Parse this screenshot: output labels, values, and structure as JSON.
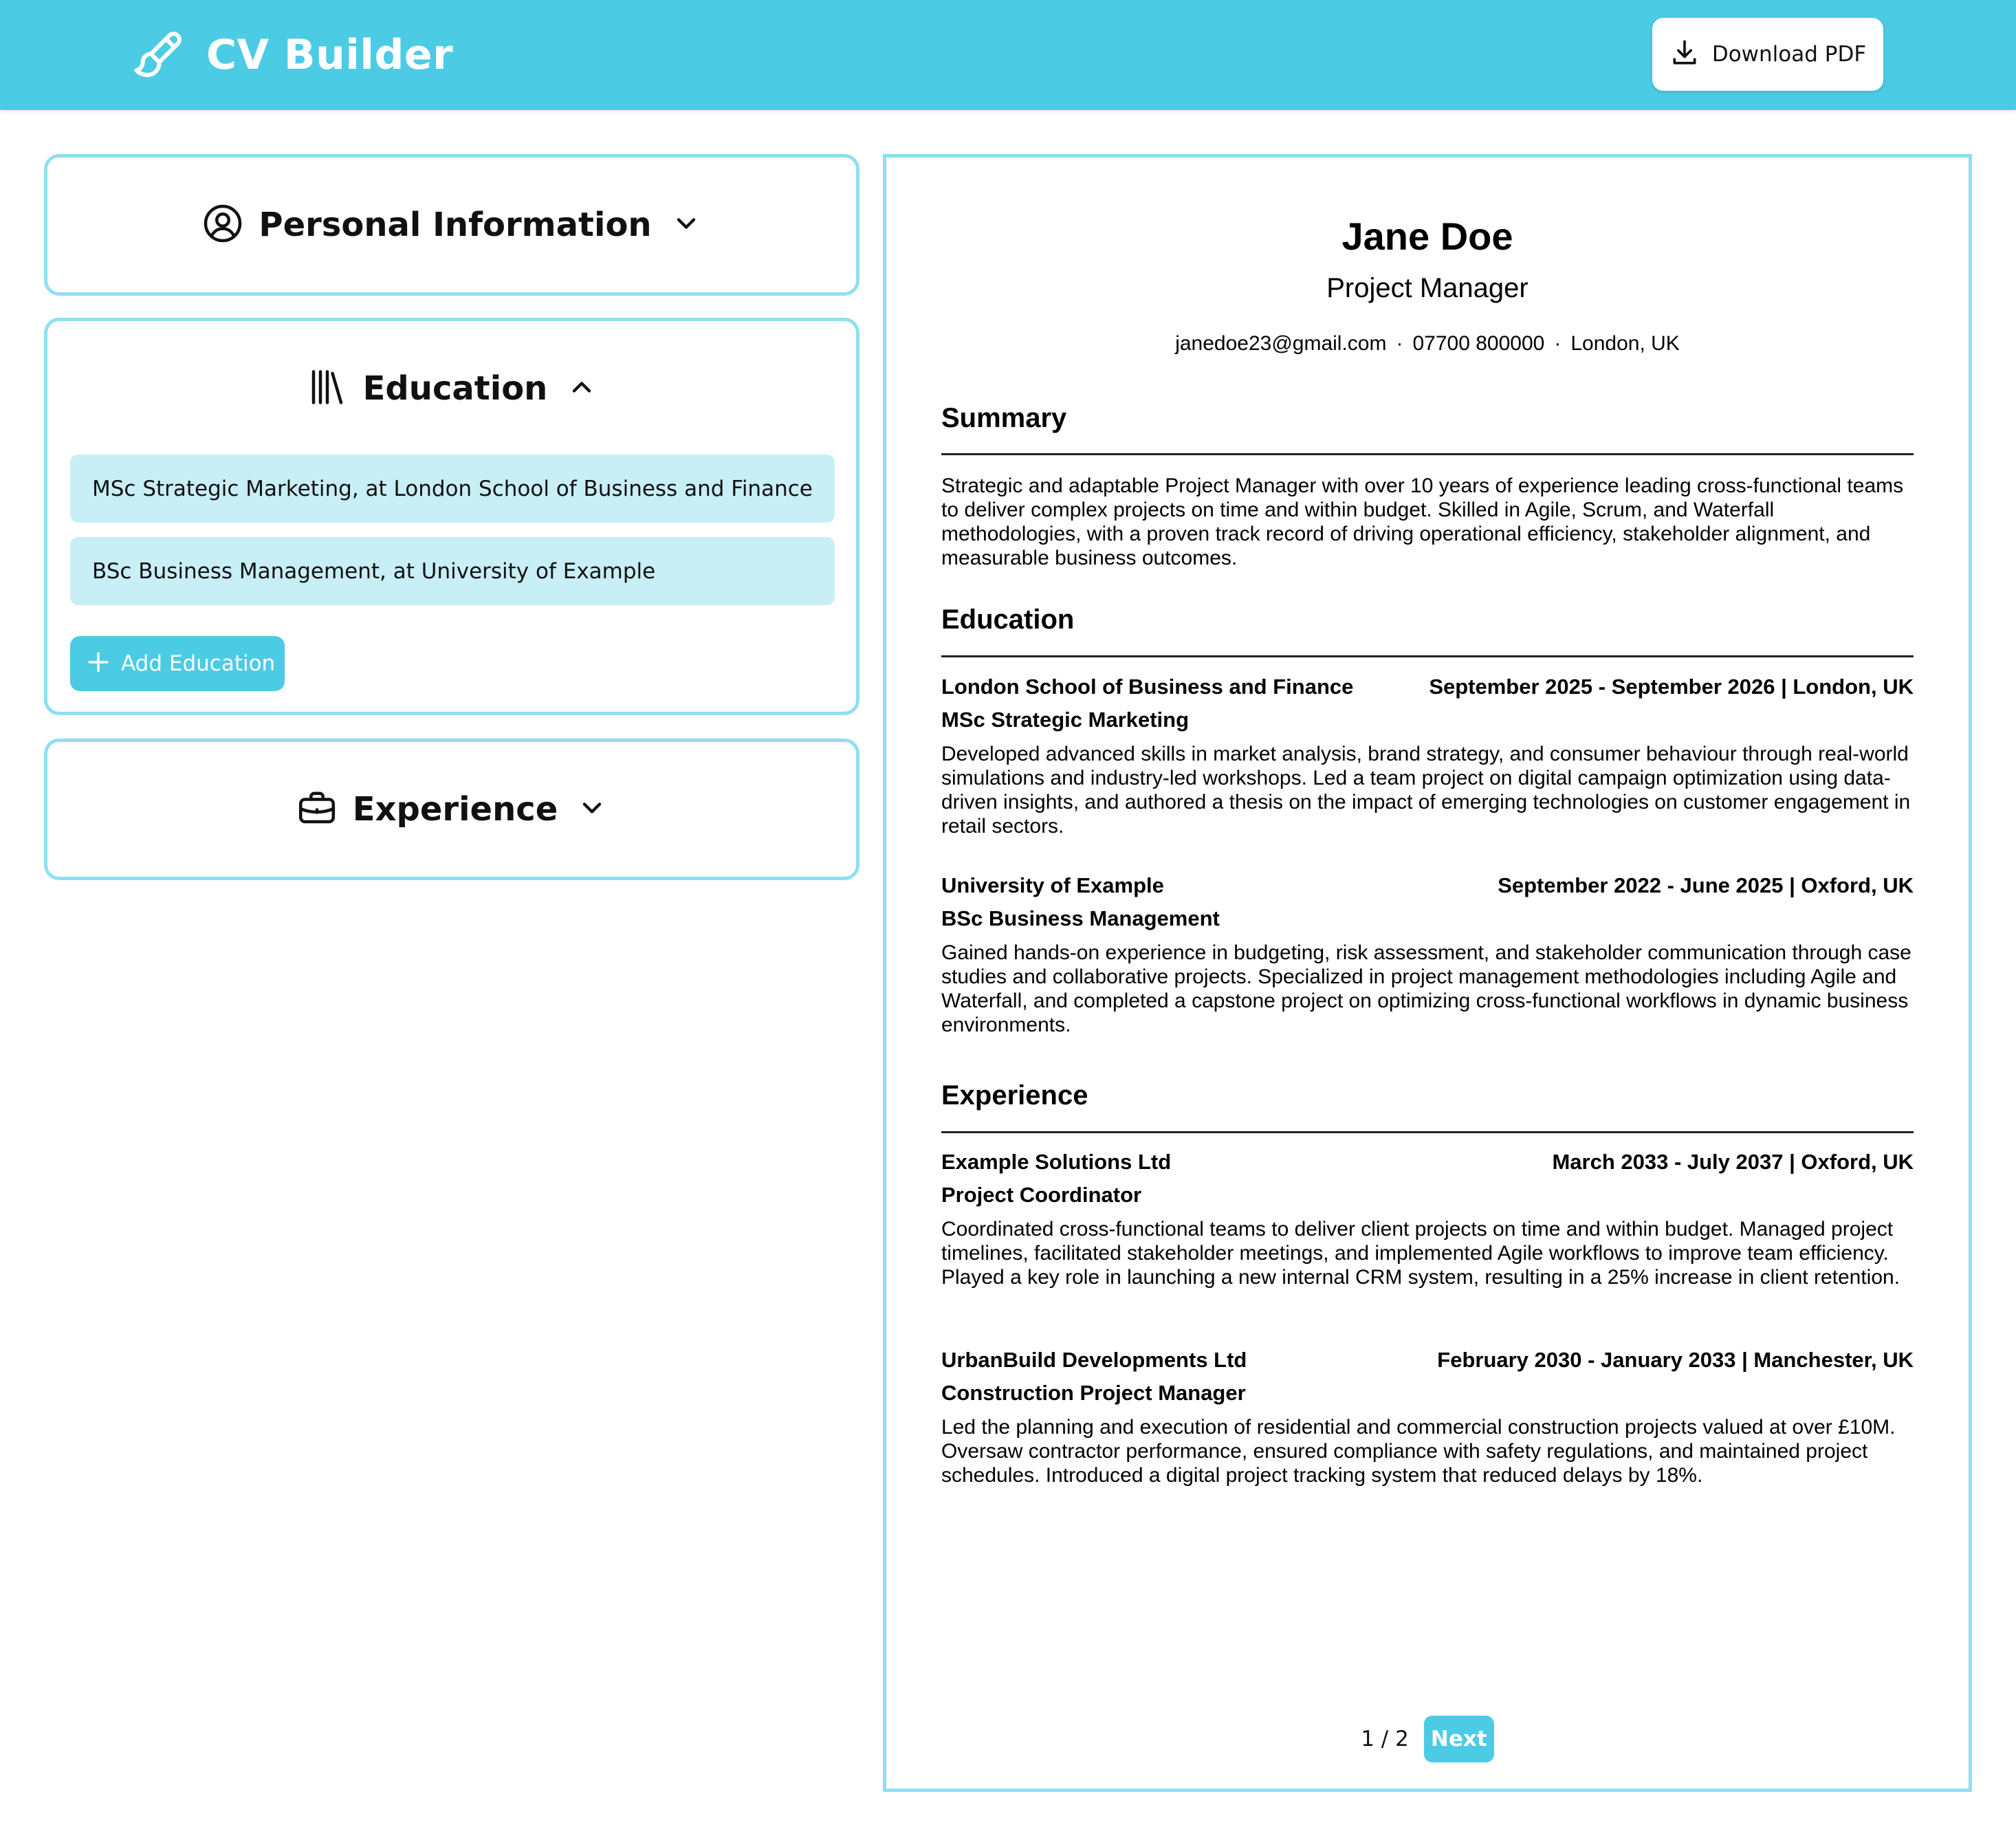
{
  "app": {
    "title": "CV Builder",
    "download_label": "Download PDF"
  },
  "panels": {
    "personal": {
      "title": "Personal Information"
    },
    "education": {
      "title": "Education",
      "items": [
        {
          "label": "MSc Strategic Marketing, at London School of Business and Finance"
        },
        {
          "label": "BSc Business Management, at University of Example"
        }
      ],
      "add_label": "Add Education"
    },
    "experience": {
      "title": "Experience"
    }
  },
  "cv": {
    "name": "Jane Doe",
    "role": "Project Manager",
    "email": "janedoe23@gmail.com",
    "phone": "07700 800000",
    "location": "London, UK",
    "separator": "·",
    "summary_title": "Summary",
    "summary": "Strategic and adaptable Project Manager with over 10 years of experience leading cross-functional teams to deliver complex projects on time and within budget. Skilled in Agile, Scrum, and Waterfall methodologies, with a proven track record of driving operational efficiency, stakeholder alignment, and measurable business outcomes.",
    "education_title": "Education",
    "education": [
      {
        "institution": "London School of Business and Finance",
        "dates_location": "September 2025 - September 2026 | London, UK",
        "degree": "MSc Strategic Marketing",
        "description": "Developed advanced skills in market analysis, brand strategy, and consumer behaviour through real-world simulations and industry-led workshops. Led a team project on digital campaign optimization using data-driven insights, and authored a thesis on the impact of emerging technologies on customer engagement in retail sectors."
      },
      {
        "institution": "University of Example",
        "dates_location": "September 2022 - June 2025 | Oxford, UK",
        "degree": "BSc Business Management",
        "description": "Gained hands-on experience in budgeting, risk assessment, and stakeholder communication through case studies and collaborative projects. Specialized in project management methodologies including Agile and Waterfall, and completed a capstone project on optimizing cross-functional workflows in dynamic business environments."
      }
    ],
    "experience_title": "Experience",
    "experience": [
      {
        "company": "Example Solutions Ltd",
        "dates_location": "March 2033 - July 2037 | Oxford, UK",
        "position": "Project Coordinator",
        "description": "Coordinated cross-functional teams to deliver client projects on time and within budget. Managed project timelines, facilitated stakeholder meetings, and implemented Agile workflows to improve team efficiency. Played a key role in launching a new internal CRM system, resulting in a 25% increase in client retention."
      },
      {
        "company": "UrbanBuild Developments Ltd",
        "dates_location": "February 2030 - January 2033 | Manchester, UK",
        "position": "Construction Project Manager",
        "description": "Led the planning and execution of residential and commercial construction projects valued at over £10M. Oversaw contractor performance, ensured compliance with safety regulations, and maintained project schedules. Introduced a digital project tracking system that reduced delays by 18%."
      }
    ]
  },
  "pager": {
    "count": "1 / 2",
    "next_label": "Next"
  },
  "icons": {
    "brand": "paintbrush-icon",
    "download": "download-icon",
    "personal": "user-circle-icon",
    "education": "books-icon",
    "experience": "briefcase-icon",
    "add": "plus-icon"
  },
  "colors": {
    "accent": "#4ccbe5",
    "panel_border": "#8ee0f0",
    "item_bg": "#c8eef6"
  }
}
